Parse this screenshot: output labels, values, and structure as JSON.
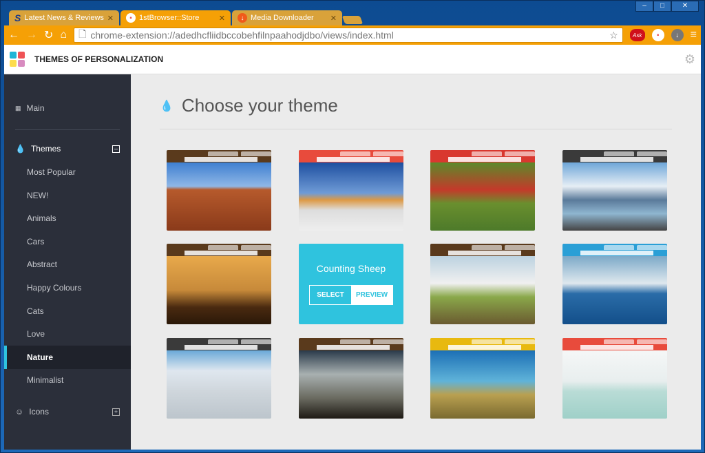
{
  "browser": {
    "tabs": [
      {
        "label": "Latest News & Reviews by",
        "icon": "softpedia-s-icon"
      },
      {
        "label": "1stBrowser::Store",
        "icon": "store-icon",
        "active": true
      },
      {
        "label": "Media Downloader",
        "icon": "download-icon"
      }
    ],
    "url": "chrome-extension://adedhcfliidbccobehfilnpaahodjdbo/views/index.html",
    "ask_label": "Ask"
  },
  "app": {
    "title": "THEMES OF PERSONALIZATION",
    "logo_colors": [
      "#1fb5d6",
      "#ef5356",
      "#fddc4e",
      "#d88bc0"
    ]
  },
  "sidebar": {
    "main": "Main",
    "themes": "Themes",
    "icons": "Icons",
    "items": [
      "Most Popular",
      "NEW!",
      "Animals",
      "Cars",
      "Abstract",
      "Happy Colours",
      "Cats",
      "Love",
      "Nature",
      "Minimalist"
    ],
    "selected": "Nature"
  },
  "content": {
    "heading": "Choose your theme",
    "hover": {
      "name": "Counting Sheep",
      "select": "SELECT",
      "preview": "PREVIEW"
    },
    "themes": [
      {
        "bar": "#5a3a1c",
        "img": "linear-gradient(#3f7fd0 0%,#8fb7e6 35%,#b65a2c 40%,#8a3a1a 100%)"
      },
      {
        "bar": "#e84b3c",
        "img": "linear-gradient(#1e4fa0 0%,#6f9bd6 45%,#d94 55%,#ddd 70%,#eee 100%)"
      },
      {
        "bar": "#d9382f",
        "img": "linear-gradient(#5b8a2a 0%,#c43a2a 40%,#6a8f2e 60%,#4d7a2a 100%)"
      },
      {
        "bar": "#3a3a3a",
        "img": "linear-gradient(#6ea6d8 0%,#e6eef5 35%,#5a7a9a 55%,#8fb6d0 75%,#444 100%)"
      },
      {
        "bar": "#5a3a1c",
        "img": "linear-gradient(#e8a94b 0%,#c78a3a 50%,#4a2a10 75%,#2a1808 100%)"
      },
      {
        "bar": "#2fc3de",
        "img": "#2fc3de",
        "hover": true
      },
      {
        "bar": "#5a3a1c",
        "img": "linear-gradient(#bcd2e0 0%,#f0f0f0 40%,#8aa84a 60%,#6a5a30 100%)"
      },
      {
        "bar": "#2a9fd6",
        "img": "linear-gradient(#7ca9c8 0%,#dfe8ee 40%,#2a6ca8 55%,#134f8a 100%)"
      },
      {
        "bar": "#3a3a3a",
        "img": "linear-gradient(#6aa9d8 0%,#dfe7ef 30%,#cfd6dc 60%,#bcc5cc 100%)"
      },
      {
        "bar": "#5a3a1c",
        "img": "linear-gradient(#2a3a4a 0%,#a8b0b0 35%,#6a6a60 70%,#1e1a14 100%)"
      },
      {
        "bar": "#e8b90f",
        "img": "linear-gradient(#1c6fb5 0%,#5fb3d9 45%,#b9a050 65%,#7a6a30 100%)"
      },
      {
        "bar": "#e84b3c",
        "img": "linear-gradient(#f5f7f7 0%,#e8eeee 45%,#b9dcd6 60%,#9fd0c8 100%)"
      }
    ]
  }
}
